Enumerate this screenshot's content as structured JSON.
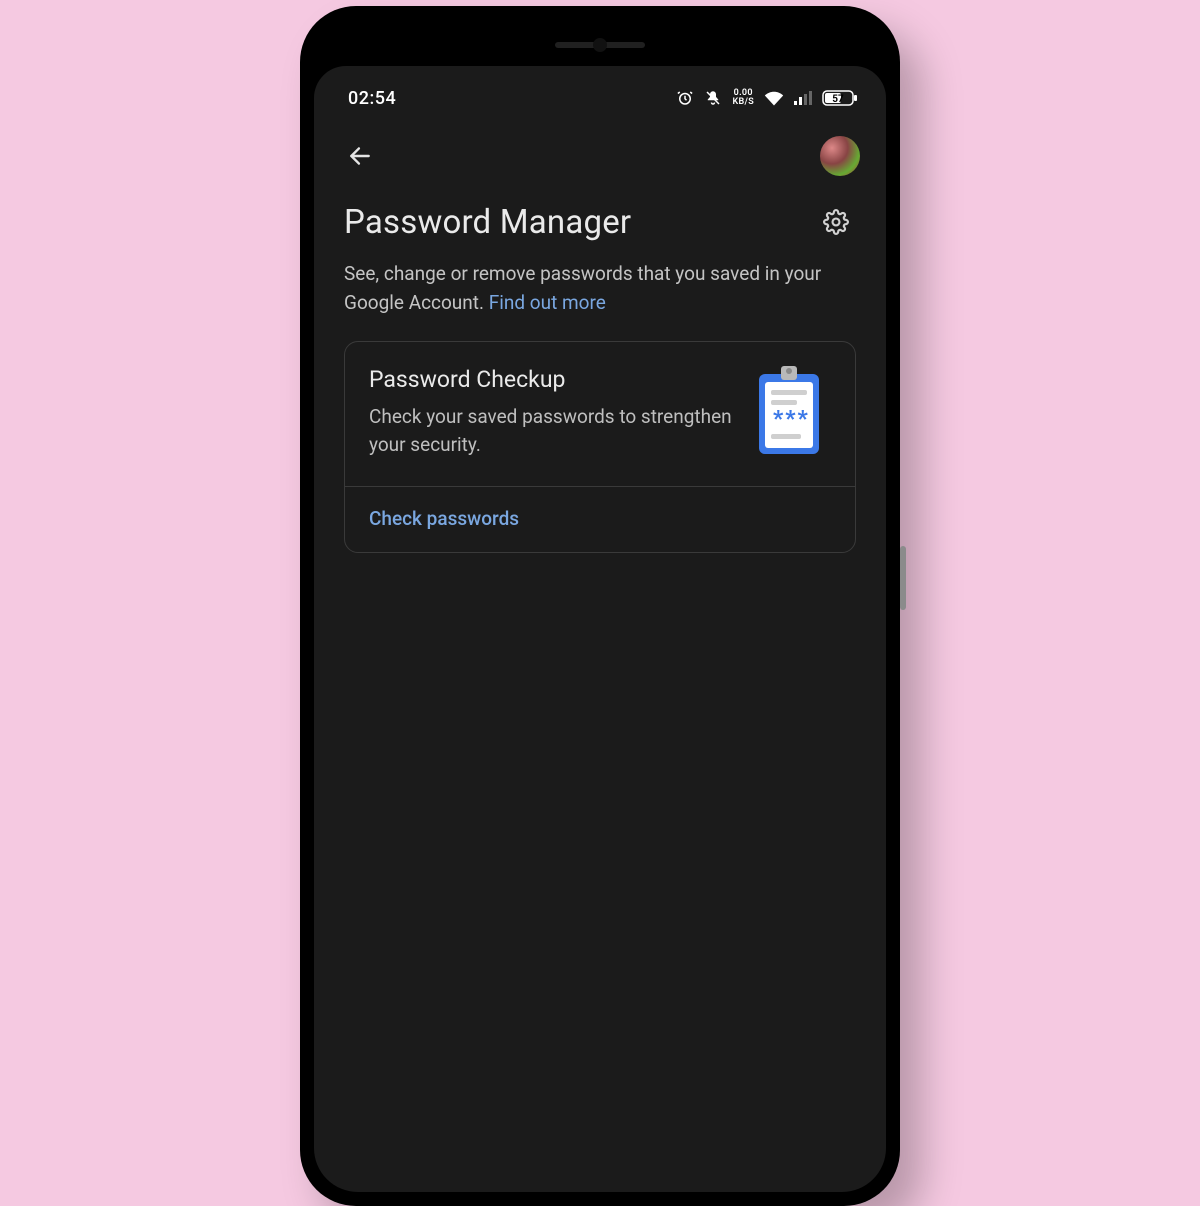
{
  "status": {
    "time": "02:54",
    "data_rate_top": "0.00",
    "data_rate_bottom": "KB/S",
    "battery": "57"
  },
  "header": {
    "title": "Password Manager",
    "subtitle": "See, change or remove passwords that you saved in your Google Account. ",
    "learn_more": "Find out more"
  },
  "checkup": {
    "title": "Password Checkup",
    "desc": "Check your saved passwords to strengthen your security.",
    "action": "Check passwords"
  }
}
